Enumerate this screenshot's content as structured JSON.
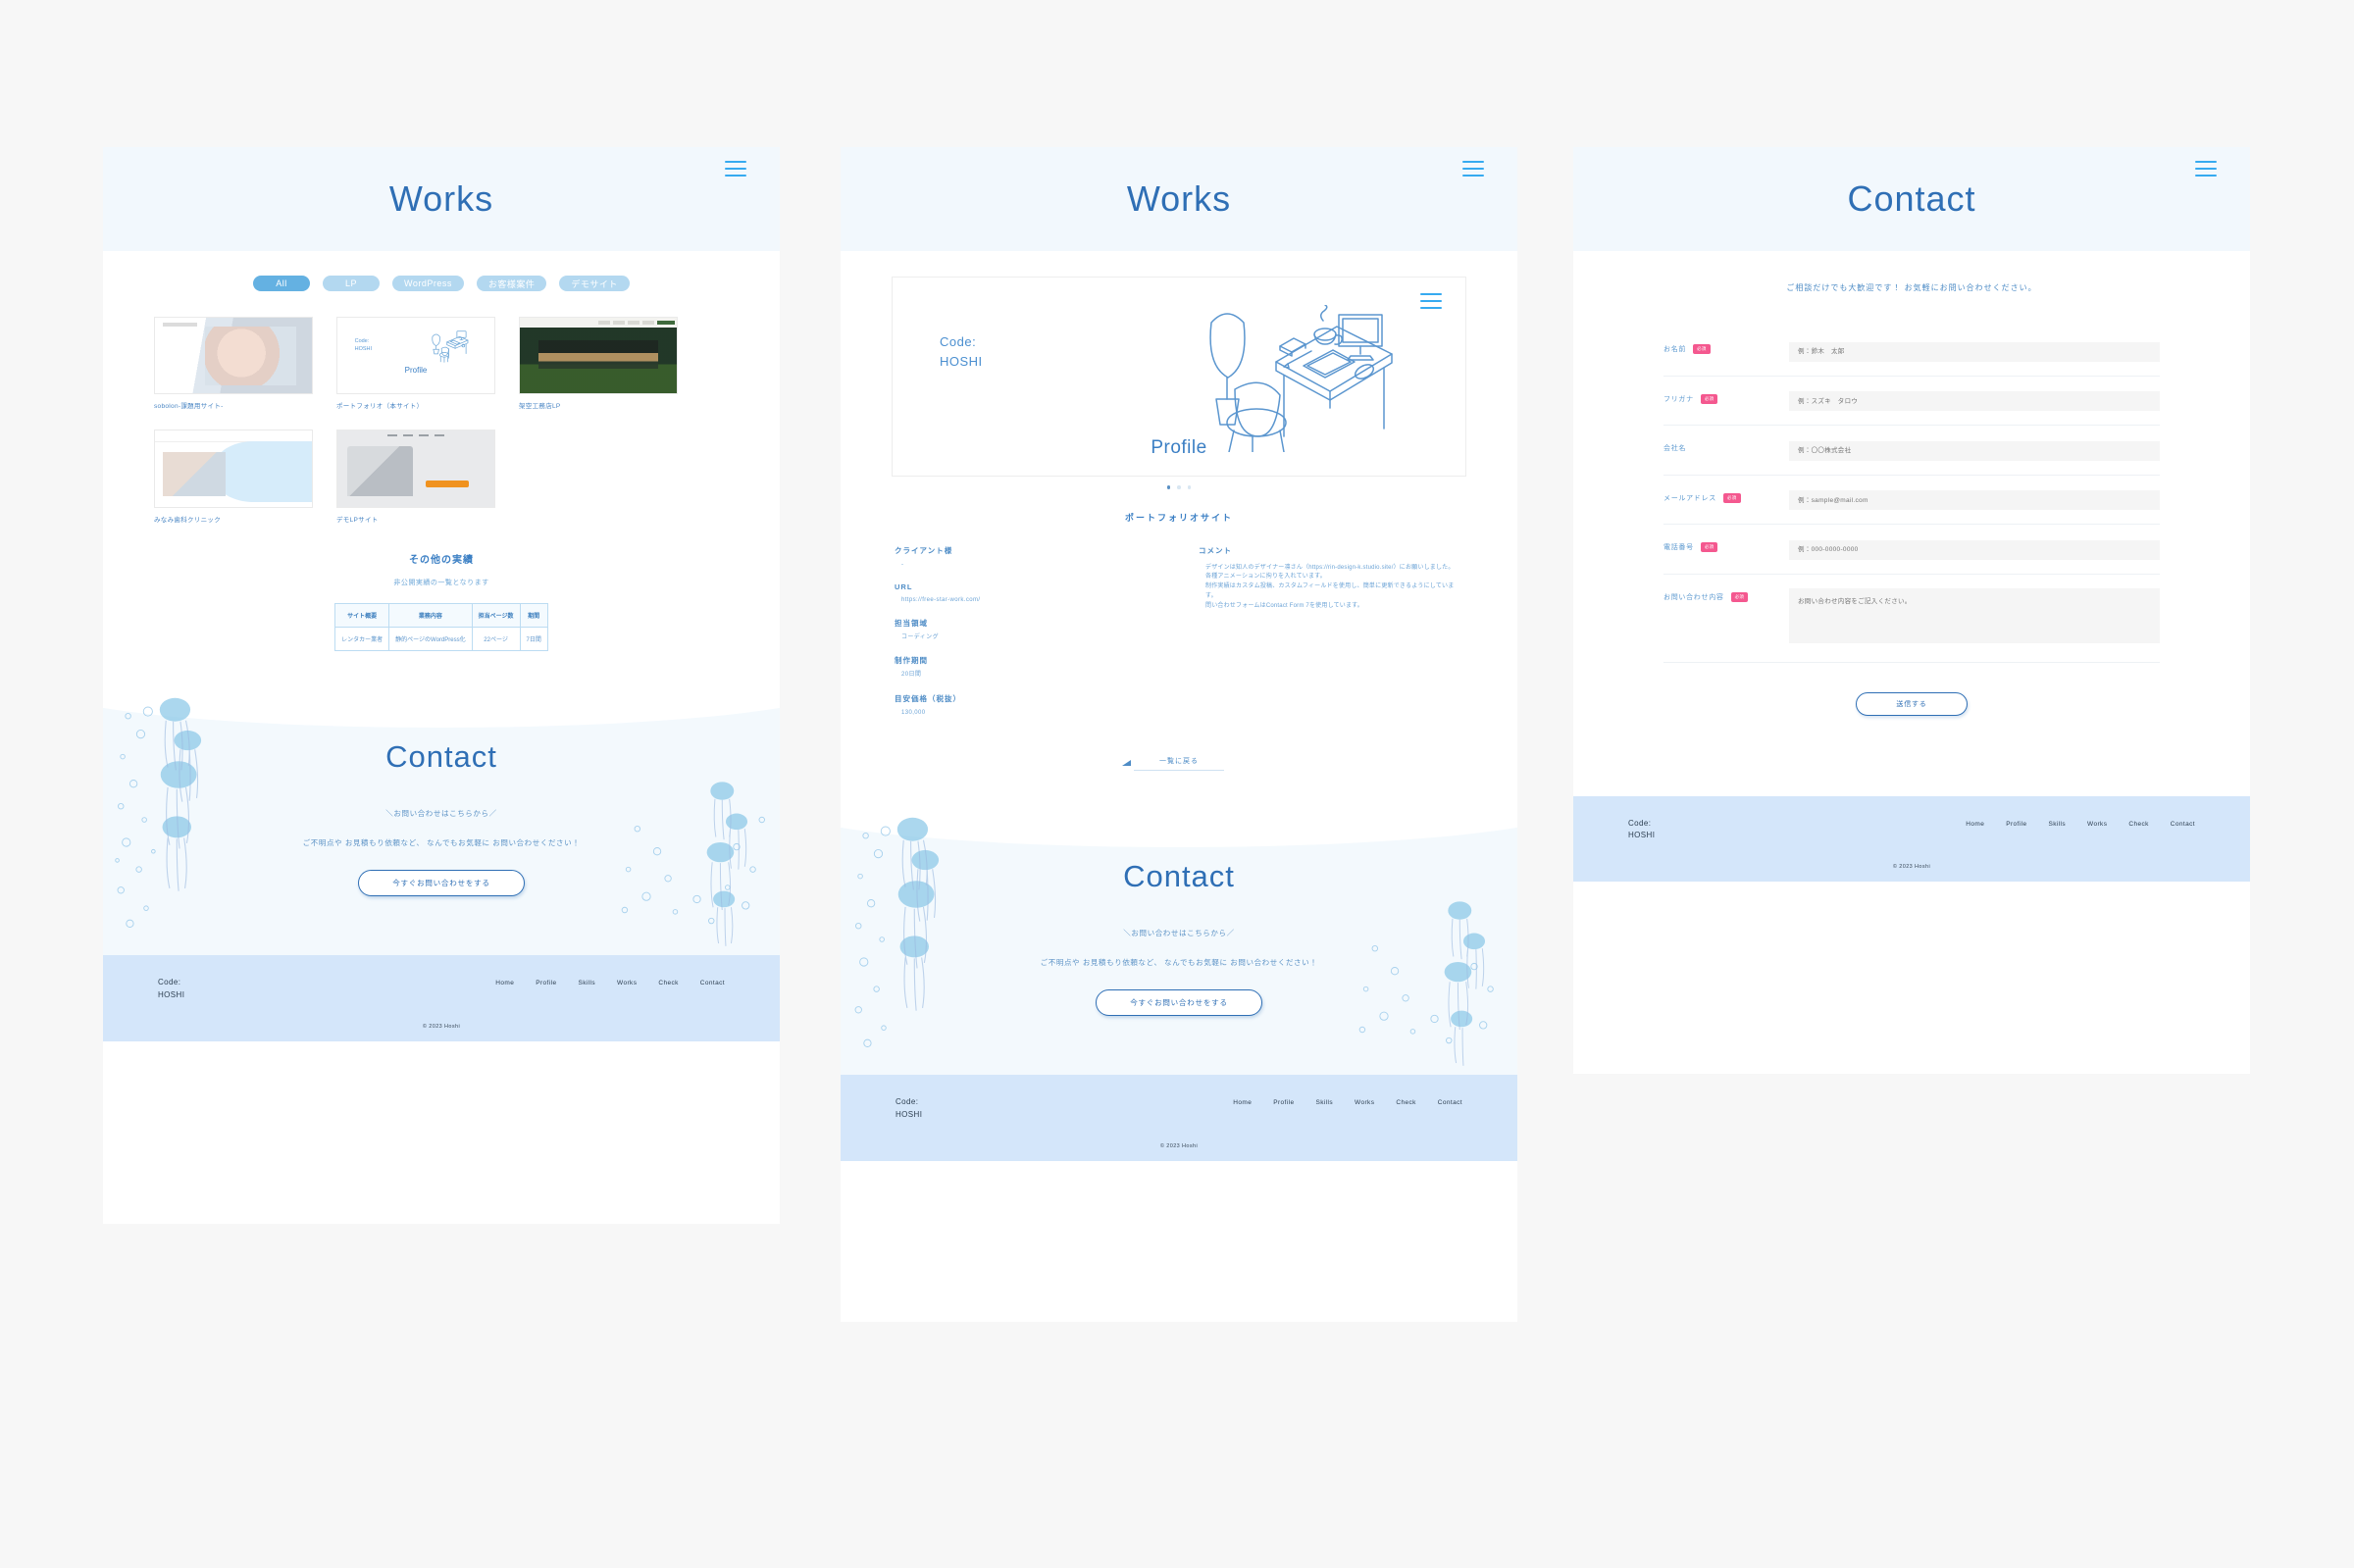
{
  "site": {
    "logo_line1": "Code:",
    "logo_line2": "HOSHI",
    "copyright": "© 2023 Hoshi",
    "nav": [
      "Home",
      "Profile",
      "Skills",
      "Works",
      "Check",
      "Contact"
    ],
    "menu_icon": "hamburger-menu-icon"
  },
  "panels": {
    "works_list": {
      "hero_title": "Works",
      "filters": [
        {
          "label": "All",
          "active": true
        },
        {
          "label": "LP",
          "active": false
        },
        {
          "label": "WordPress",
          "active": false
        },
        {
          "label": "お客様案件",
          "active": false
        },
        {
          "label": "デモサイト",
          "active": false
        }
      ],
      "works": [
        {
          "caption": "sobolon-課題用サイト-",
          "art": "t-sobolon"
        },
        {
          "caption": "ポートフォリオ（本サイト）",
          "art": "t-portfolio"
        },
        {
          "caption": "架空工務店LP",
          "art": "t-koumuten"
        },
        {
          "caption": "みなみ歯科クリニック",
          "art": "t-dental"
        },
        {
          "caption": "デモLPサイト",
          "art": "t-demolp"
        }
      ],
      "other_works": {
        "title": "その他の実績",
        "subtitle": "非公開実績の一覧となります",
        "columns": [
          "サイト概要",
          "業務内容",
          "担当ページ数",
          "期間"
        ],
        "rows": [
          [
            "レンタカー業者",
            "静的ページのWordPress化",
            "22ページ",
            "7日間"
          ]
        ]
      }
    },
    "works_detail": {
      "hero_title": "Works",
      "card": {
        "code_line1": "Code:",
        "code_line2": "HOSHI",
        "profile_label": "Profile",
        "illustration": "desk-workspace-illustration",
        "dots": 3,
        "active_dot": 0
      },
      "title": "ポートフォリオサイト",
      "left_fields": [
        {
          "label": "クライアント様",
          "value": "-"
        },
        {
          "label": "URL",
          "value": "https://free-star-work.com/"
        },
        {
          "label": "担当領域",
          "value": "コーディング"
        },
        {
          "label": "制作期間",
          "value": "20日間"
        },
        {
          "label": "目安価格（税抜）",
          "value": "130,000"
        }
      ],
      "comment_label": "コメント",
      "comment_body": "デザインは知人のデザイナー凛さん（https://rin-design-k.studio.site/）にお願いしました。\n各種アニメーションに拘りを入れています。\n制作実績はカスタム投稿、カスタムフィールドを使用し、簡単に更新できるようにしています。\n問い合わせフォームはContact Form 7を使用しています。",
      "back_label": "一覧に戻る"
    },
    "contact": {
      "hero_title": "Contact",
      "intro": "ご相談だけでも大歓迎です！ お気軽にお問い合わせください。",
      "required_badge": "必須",
      "fields": [
        {
          "label": "お名前",
          "required": true,
          "type": "input",
          "placeholder": "例：鈴木　太郎"
        },
        {
          "label": "フリガナ",
          "required": true,
          "type": "input",
          "placeholder": "例：スズキ　タロウ"
        },
        {
          "label": "会社名",
          "required": false,
          "type": "input",
          "placeholder": "例：〇〇株式会社"
        },
        {
          "label": "メールアドレス",
          "required": true,
          "type": "input",
          "placeholder": "例：sample@mail.com"
        },
        {
          "label": "電話番号",
          "required": true,
          "type": "input",
          "placeholder": "例：000-0000-0000"
        },
        {
          "label": "お問い合わせ内容",
          "required": true,
          "type": "textarea",
          "placeholder": "お問い合わせ内容をご記入ください。"
        }
      ],
      "submit_label": "送信する"
    }
  },
  "cta": {
    "title": "Contact",
    "lead": "＼お問い合わせはこちらから／",
    "desc": "ご不明点や お見積もり依頼など、 なんでもお気軽に お問い合わせください！",
    "button": "今すぐお問い合わせをする",
    "decoration": "jellyfish-bubbles-illustration"
  },
  "colors": {
    "brand_blue": "#2f6fb5",
    "hero_bg": "#f2f8fd",
    "footer_bg": "#d4e6fa",
    "pill": "#b3d8f0",
    "pill_active": "#64b1e2",
    "required_pink": "#f4588f",
    "menu_icon": "#36aaf0"
  }
}
